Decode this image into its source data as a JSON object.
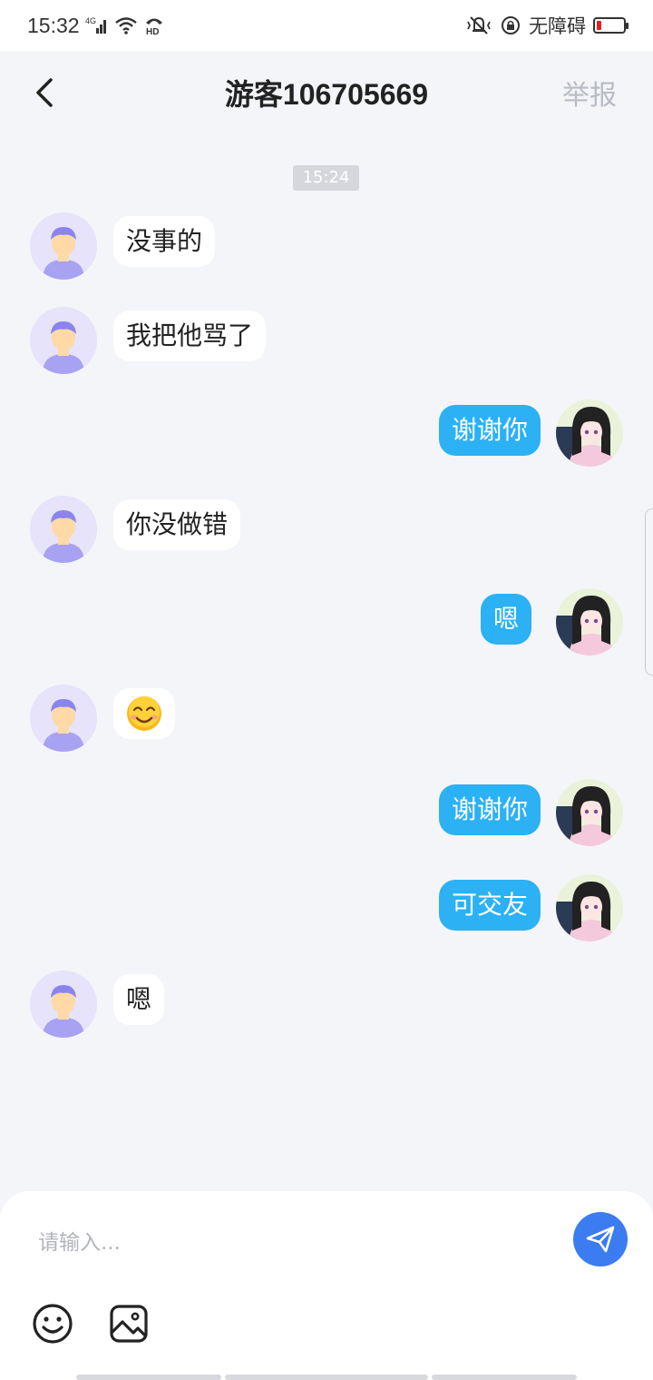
{
  "status_bar": {
    "time": "15:32",
    "network": "4G",
    "hd": "HD",
    "accessibility_label": "无障碍",
    "battery_color": "#e02020"
  },
  "header": {
    "title": "游客106705669",
    "report_label": "举报"
  },
  "chat": {
    "timestamp": "15:24",
    "messages": [
      {
        "side": "left",
        "text": "没事的"
      },
      {
        "side": "left",
        "text": "我把他骂了"
      },
      {
        "side": "right",
        "text": "谢谢你"
      },
      {
        "side": "left",
        "text": "你没做错"
      },
      {
        "side": "right",
        "text": "嗯"
      },
      {
        "side": "left",
        "emoji": "smiling-face"
      },
      {
        "side": "right",
        "text": "谢谢你"
      },
      {
        "side": "right",
        "text": "可交友"
      },
      {
        "side": "left",
        "text": "嗯"
      }
    ]
  },
  "input": {
    "placeholder": "请输入..."
  },
  "colors": {
    "background": "#f4f5f8",
    "outgoing_bubble": "#2bb1f4",
    "incoming_bubble": "#ffffff",
    "send_button": "#3b7cf0",
    "report_text": "#b9bcc4"
  }
}
